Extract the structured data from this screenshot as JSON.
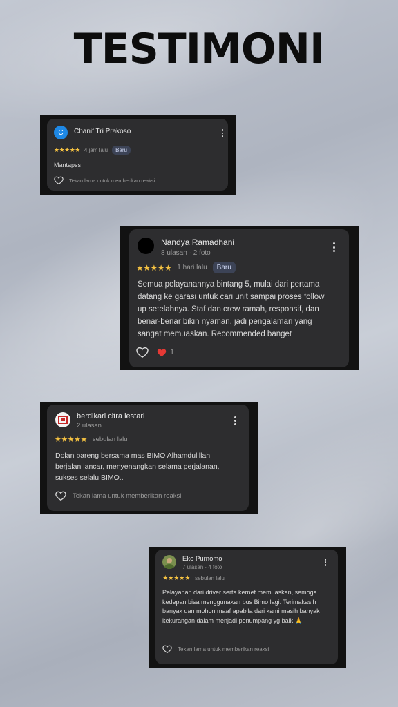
{
  "page": {
    "title": "TESTIMONI"
  },
  "reviews": [
    {
      "avatar_letter": "C",
      "avatar_color": "#1e88e5",
      "name": "Chanif Tri Prakoso",
      "stars": "★★★★★",
      "time": "4 jam lalu",
      "badge": "Baru",
      "text": "Mantapss",
      "reaction_hint": "Tekan lama untuk memberikan reaksi"
    },
    {
      "name": "Nandya Ramadhani",
      "meta": "8 ulasan · 2 foto",
      "stars": "★★★★★",
      "time": "1 hari lalu",
      "badge": "Baru",
      "text": "Semua pelayanannya bintang 5, mulai dari pertama datang ke garasi untuk cari unit sampai proses follow up setelahnya. Staf dan crew ramah, responsif, dan benar-benar bikin nyaman, jadi pengalaman yang sangat memuaskan. Recommended banget",
      "reaction_count": "1"
    },
    {
      "name": "berdikari citra lestari",
      "meta": "2 ulasan",
      "stars": "★★★★★",
      "time": "sebulan lalu",
      "text": "Dolan bareng bersama mas BIMO Alhamdulillah berjalan lancar, menyenangkan selama perjalanan, sukses selalu BIMO..",
      "reaction_hint": "Tekan lama untuk memberikan reaksi"
    },
    {
      "name": "Eko Purnomo",
      "meta": "7 ulasan · 4 foto",
      "stars": "★★★★★",
      "time": "sebulan lalu",
      "text": "Pelayanan dari driver serta kernet memuaskan, semoga kedepan bisa menggunakan bus Bimo lagi. Terimakasih banyak dan mohon maaf apabila dari kami masih banyak kekurangan dalam menjadi penumpang yg baik 🙏",
      "reaction_hint": "Tekan lama untuk memberikan reaksi"
    }
  ]
}
